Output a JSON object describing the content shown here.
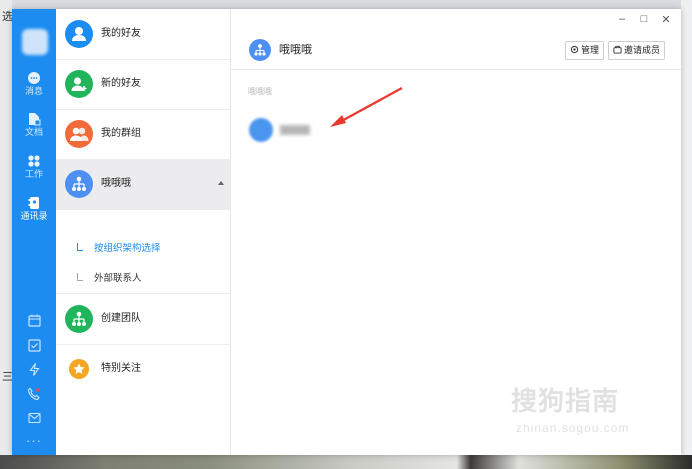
{
  "desktop": {
    "left_text_top": "选",
    "left_text_mid": "三"
  },
  "nav_rail": {
    "items": [
      {
        "label": "消息",
        "icon": "chat-icon"
      },
      {
        "label": "文档",
        "icon": "document-icon"
      },
      {
        "label": "工作",
        "icon": "apps-grid-icon"
      },
      {
        "label": "通讯录",
        "icon": "contacts-icon"
      }
    ],
    "bottom_icons": [
      "calendar-icon",
      "task-check-icon",
      "lightning-icon",
      "phone-call-icon",
      "mail-icon",
      "more-dots-icon"
    ],
    "active": "通讯录",
    "colors": {
      "rail": "#1c8cf0"
    }
  },
  "contacts_panel": {
    "items": [
      {
        "label": "我的好友",
        "icon": "person-icon",
        "color": "#1c8cf0"
      },
      {
        "label": "新的好友",
        "icon": "add-person-icon",
        "color": "#20b55a"
      },
      {
        "label": "我的群组",
        "icon": "group-icon",
        "color": "#f06a3a"
      },
      {
        "label": "哦哦哦",
        "icon": "org-tree-icon",
        "color": "#4d8ff2"
      }
    ],
    "sub_items": [
      {
        "label": "按组织架构选择"
      },
      {
        "label": "外部联系人"
      }
    ],
    "items_after": [
      {
        "label": "创建团队",
        "icon": "org-tree-icon",
        "color": "#20b55a"
      },
      {
        "label": "特别关注",
        "icon": "star-icon",
        "color": "#f5a623"
      }
    ]
  },
  "main": {
    "title": "哦哦哦",
    "buttons": {
      "manage": "管理",
      "invite": "邀请成员"
    },
    "section_label": "哦哦哦"
  },
  "watermark": {
    "text": "搜狗指南",
    "url": "zhinan.sogou.com"
  }
}
